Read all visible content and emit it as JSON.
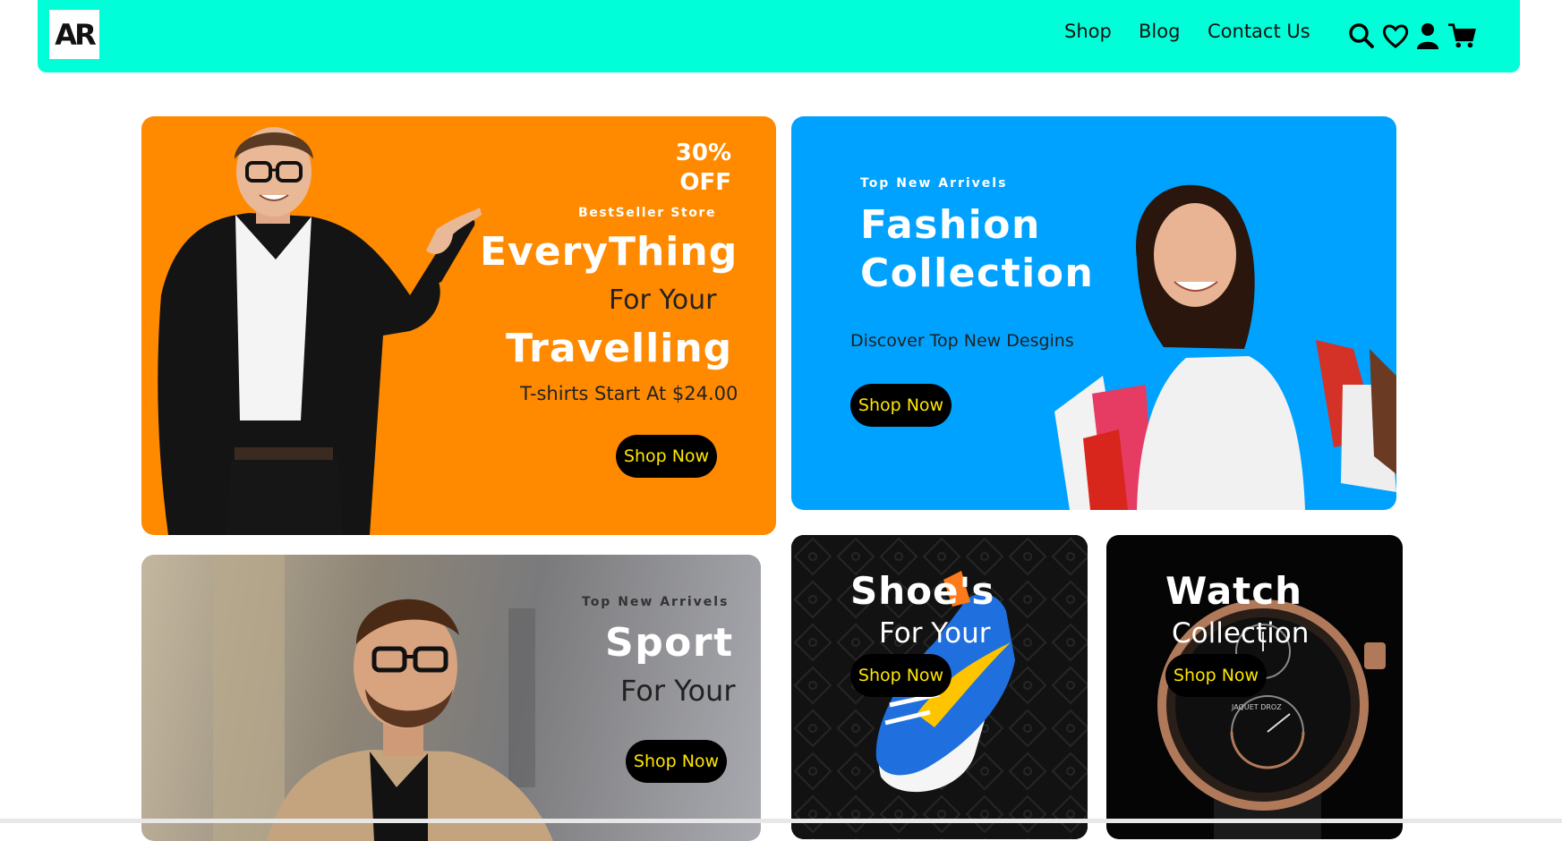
{
  "header": {
    "logo_text": "AR",
    "nav": {
      "shop": "Shop",
      "blog": "Blog",
      "contact": "Contact Us"
    },
    "icons": [
      "search-icon",
      "heart-icon",
      "user-icon",
      "cart-icon"
    ],
    "bg_color": "#00ffd8"
  },
  "cards": {
    "travel": {
      "discount": "30%\nOFF",
      "store": "BestSeller Store",
      "line1": "EveryThing",
      "line2": "For Your",
      "line3": "Travelling",
      "sub": "T-shirts Start At $24.00",
      "button": "Shop Now",
      "bg_color": "#ff8a00"
    },
    "fashion": {
      "top": "Top New Arrivels",
      "title": "Fashion\nCollection",
      "sub": "Discover Top New Desgins",
      "button": "Shop Now",
      "bg_color": "#00a2ff"
    },
    "sport": {
      "top": "Top New Arrivels",
      "title": "Sport",
      "line2": "For Your",
      "button": "Shop Now"
    },
    "shoes": {
      "title": "Shoe's",
      "line2": "For Your",
      "button": "Shop Now"
    },
    "watch": {
      "title": "Watch",
      "line2": "Collection",
      "button": "Shop Now",
      "dial_text": "JAQUET DROZ"
    }
  },
  "colors": {
    "button_bg": "#000000",
    "button_text": "#ffe600"
  }
}
